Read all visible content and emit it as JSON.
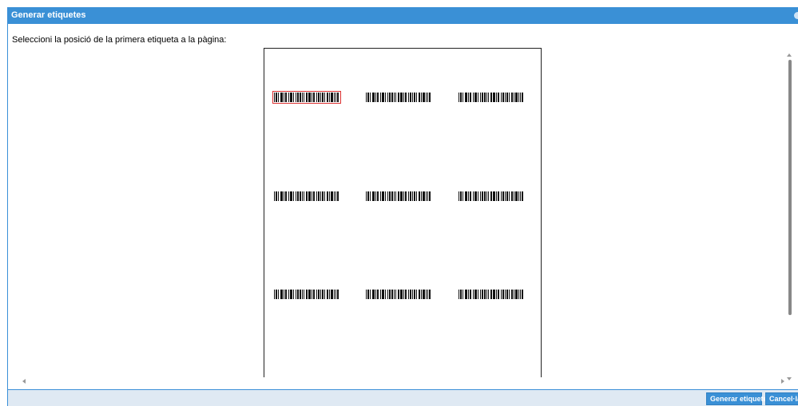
{
  "dialog": {
    "title": "Generar etiquetes",
    "instruction": "Seleccioni la posició de la primera etiqueta a la pàgina:",
    "accent_color": "#3a90d6",
    "selected_border_color": "#dd3333"
  },
  "labels": {
    "rows": 3,
    "columns": 3,
    "selected_position": 1
  },
  "footer": {
    "generate_label": "Generar etiquetes",
    "cancel_label": "Cancel·lar"
  }
}
